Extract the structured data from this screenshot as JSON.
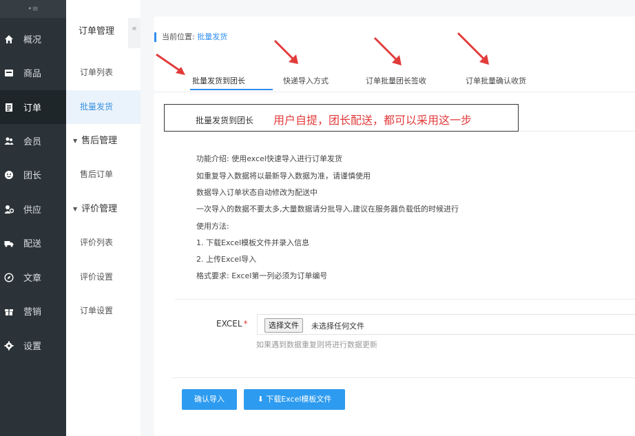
{
  "sidebar": {
    "toggle_glyph": "•≡",
    "items": [
      {
        "label": "概况",
        "icon": "home-icon"
      },
      {
        "label": "商品",
        "icon": "product-icon"
      },
      {
        "label": "订单",
        "icon": "order-icon",
        "active": true
      },
      {
        "label": "会员",
        "icon": "users-icon"
      },
      {
        "label": "团长",
        "icon": "leader-icon"
      },
      {
        "label": "供应",
        "icon": "supply-icon"
      },
      {
        "label": "配送",
        "icon": "truck-icon"
      },
      {
        "label": "文章",
        "icon": "compass-icon"
      },
      {
        "label": "营销",
        "icon": "gift-icon"
      },
      {
        "label": "设置",
        "icon": "gear-icon"
      }
    ]
  },
  "subnav": {
    "title": "订单管理",
    "collapse_glyph": "«",
    "items": [
      {
        "label": "订单列表"
      },
      {
        "label": "批量发货",
        "active": true
      },
      {
        "label": "售后管理",
        "group": true
      },
      {
        "label": "售后订单"
      },
      {
        "label": "评价管理",
        "group": true
      },
      {
        "label": "评价列表"
      },
      {
        "label": "评价设置"
      },
      {
        "label": "订单设置"
      }
    ]
  },
  "breadcrumb": {
    "prefix": "当前位置:",
    "current": "批量发货"
  },
  "tabs": [
    {
      "label": "批量发货到团长",
      "active": true
    },
    {
      "label": "快递导入方式"
    },
    {
      "label": "订单批量团长签收"
    },
    {
      "label": "订单批量确认收货"
    }
  ],
  "highlight": {
    "title": "批量发货到团长",
    "note": "用户自提，团长配送，都可以采用这一步"
  },
  "description": {
    "lines": [
      "功能介绍: 使用excel快速导入进行订单发货",
      "如重复导入数据将以最新导入数据为准，请谨慎使用",
      "数据导入订单状态自动修改为配送中",
      "一次导入的数据不要太多,大量数据请分批导入,建议在服务器负载低的时候进行",
      "使用方法:",
      "1. 下载Excel模板文件并录入信息",
      "2. 上传Excel导入",
      "格式要求:  Excel第一列必须为订单编号"
    ]
  },
  "form": {
    "excel_label": "EXCEL",
    "required_mark": "*",
    "file_button": "选择文件",
    "file_status": "未选择任何文件",
    "hint": "如果遇到数据重复则将进行数据更新"
  },
  "buttons": {
    "confirm": "确认导入",
    "download": "下载Excel模板文件"
  },
  "colors": {
    "sidebar_bg": "#2b3338",
    "accent": "#2d8ef0",
    "button": "#2d9bf0",
    "annotation_red": "#e23b3b"
  }
}
